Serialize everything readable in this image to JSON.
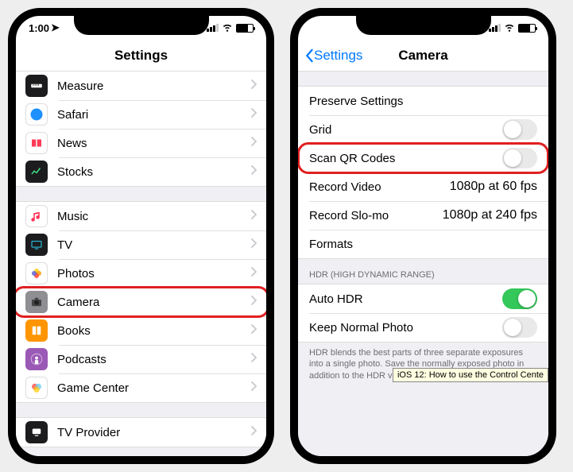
{
  "left": {
    "status": {
      "time": "1:00"
    },
    "title": "Settings",
    "groups": [
      {
        "items": [
          {
            "icon": "measure",
            "label": "Measure"
          },
          {
            "icon": "safari",
            "label": "Safari"
          },
          {
            "icon": "news",
            "label": "News"
          },
          {
            "icon": "stocks",
            "label": "Stocks"
          }
        ]
      },
      {
        "items": [
          {
            "icon": "music",
            "label": "Music"
          },
          {
            "icon": "tv",
            "label": "TV"
          },
          {
            "icon": "photos",
            "label": "Photos"
          },
          {
            "icon": "camera",
            "label": "Camera",
            "highlight": true
          },
          {
            "icon": "books",
            "label": "Books"
          },
          {
            "icon": "podcasts",
            "label": "Podcasts"
          },
          {
            "icon": "gamecenter",
            "label": "Game Center"
          }
        ]
      },
      {
        "items": [
          {
            "icon": "tvprovider",
            "label": "TV Provider"
          }
        ]
      }
    ]
  },
  "right": {
    "back": "Settings",
    "title": "Camera",
    "group1": [
      {
        "label": "Preserve Settings",
        "type": "disclosure"
      },
      {
        "label": "Grid",
        "type": "toggle",
        "on": false
      },
      {
        "label": "Scan QR Codes",
        "type": "toggle",
        "on": false,
        "highlight": true
      },
      {
        "label": "Record Video",
        "type": "detail",
        "detail": "1080p at 60 fps"
      },
      {
        "label": "Record Slo-mo",
        "type": "detail",
        "detail": "1080p at 240 fps"
      },
      {
        "label": "Formats",
        "type": "disclosure"
      }
    ],
    "hdr_header": "HDR (HIGH DYNAMIC RANGE)",
    "group2": [
      {
        "label": "Auto HDR",
        "type": "toggle",
        "on": true
      },
      {
        "label": "Keep Normal Photo",
        "type": "toggle",
        "on": false
      }
    ],
    "hdr_footer": "HDR blends the best parts of three separate exposures into a single photo. Save the normally exposed photo in addition to the HDR version."
  },
  "tooltip": "iOS 12: How to use the Control Cente"
}
